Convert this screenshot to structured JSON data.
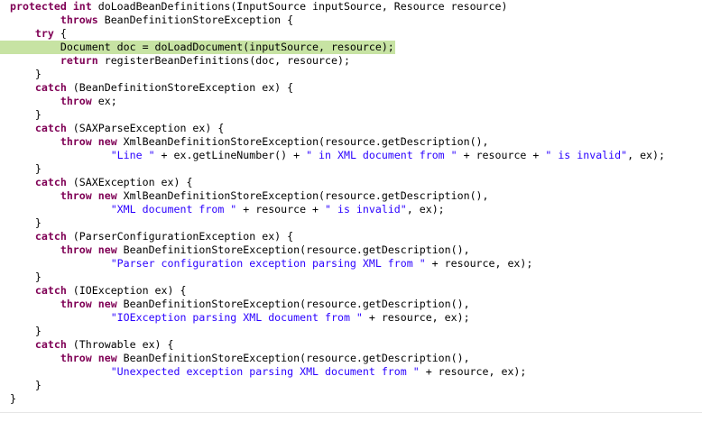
{
  "colors": {
    "keyword": "#7f0055",
    "string": "#2a00ff",
    "text": "#000000",
    "current_line": "#c7e3a3"
  },
  "lines": [
    [
      [
        "k",
        "protected"
      ],
      [
        "t",
        " "
      ],
      [
        "k",
        "int"
      ],
      [
        "t",
        " doLoadBeanDefinitions(InputSource inputSource, Resource resource)"
      ]
    ],
    [
      [
        "t",
        "        "
      ],
      [
        "k",
        "throws"
      ],
      [
        "t",
        " BeanDefinitionStoreException {"
      ]
    ],
    [
      [
        "t",
        "    "
      ],
      [
        "k",
        "try"
      ],
      [
        "t",
        " {"
      ]
    ],
    [
      [
        "t",
        "        Document doc = doLoadDocument(inputSource, resource);"
      ]
    ],
    [
      [
        "t",
        "        "
      ],
      [
        "k",
        "return"
      ],
      [
        "t",
        " registerBeanDefinitions(doc, resource);"
      ]
    ],
    [
      [
        "t",
        "    }"
      ]
    ],
    [
      [
        "t",
        "    "
      ],
      [
        "k",
        "catch"
      ],
      [
        "t",
        " (BeanDefinitionStoreException ex) {"
      ]
    ],
    [
      [
        "t",
        "        "
      ],
      [
        "k",
        "throw"
      ],
      [
        "t",
        " ex;"
      ]
    ],
    [
      [
        "t",
        "    }"
      ]
    ],
    [
      [
        "t",
        "    "
      ],
      [
        "k",
        "catch"
      ],
      [
        "t",
        " (SAXParseException ex) {"
      ]
    ],
    [
      [
        "t",
        "        "
      ],
      [
        "k",
        "throw"
      ],
      [
        "t",
        " "
      ],
      [
        "k",
        "new"
      ],
      [
        "t",
        " XmlBeanDefinitionStoreException(resource.getDescription(),"
      ]
    ],
    [
      [
        "t",
        "                "
      ],
      [
        "s",
        "\"Line \""
      ],
      [
        "t",
        " + ex.getLineNumber() + "
      ],
      [
        "s",
        "\" in XML document from \""
      ],
      [
        "t",
        " + resource + "
      ],
      [
        "s",
        "\" is invalid\""
      ],
      [
        "t",
        ", ex);"
      ]
    ],
    [
      [
        "t",
        "    }"
      ]
    ],
    [
      [
        "t",
        "    "
      ],
      [
        "k",
        "catch"
      ],
      [
        "t",
        " (SAXException ex) {"
      ]
    ],
    [
      [
        "t",
        "        "
      ],
      [
        "k",
        "throw"
      ],
      [
        "t",
        " "
      ],
      [
        "k",
        "new"
      ],
      [
        "t",
        " XmlBeanDefinitionStoreException(resource.getDescription(),"
      ]
    ],
    [
      [
        "t",
        "                "
      ],
      [
        "s",
        "\"XML document from \""
      ],
      [
        "t",
        " + resource + "
      ],
      [
        "s",
        "\" is invalid\""
      ],
      [
        "t",
        ", ex);"
      ]
    ],
    [
      [
        "t",
        "    }"
      ]
    ],
    [
      [
        "t",
        "    "
      ],
      [
        "k",
        "catch"
      ],
      [
        "t",
        " (ParserConfigurationException ex) {"
      ]
    ],
    [
      [
        "t",
        "        "
      ],
      [
        "k",
        "throw"
      ],
      [
        "t",
        " "
      ],
      [
        "k",
        "new"
      ],
      [
        "t",
        " BeanDefinitionStoreException(resource.getDescription(),"
      ]
    ],
    [
      [
        "t",
        "                "
      ],
      [
        "s",
        "\"Parser configuration exception parsing XML from \""
      ],
      [
        "t",
        " + resource, ex);"
      ]
    ],
    [
      [
        "t",
        "    }"
      ]
    ],
    [
      [
        "t",
        "    "
      ],
      [
        "k",
        "catch"
      ],
      [
        "t",
        " (IOException ex) {"
      ]
    ],
    [
      [
        "t",
        "        "
      ],
      [
        "k",
        "throw"
      ],
      [
        "t",
        " "
      ],
      [
        "k",
        "new"
      ],
      [
        "t",
        " BeanDefinitionStoreException(resource.getDescription(),"
      ]
    ],
    [
      [
        "t",
        "                "
      ],
      [
        "s",
        "\"IOException parsing XML document from \""
      ],
      [
        "t",
        " + resource, ex);"
      ]
    ],
    [
      [
        "t",
        "    }"
      ]
    ],
    [
      [
        "t",
        "    "
      ],
      [
        "k",
        "catch"
      ],
      [
        "t",
        " (Throwable ex) {"
      ]
    ],
    [
      [
        "t",
        "        "
      ],
      [
        "k",
        "throw"
      ],
      [
        "t",
        " "
      ],
      [
        "k",
        "new"
      ],
      [
        "t",
        " BeanDefinitionStoreException(resource.getDescription(),"
      ]
    ],
    [
      [
        "t",
        "                "
      ],
      [
        "s",
        "\"Unexpected exception parsing XML document from \""
      ],
      [
        "t",
        " + resource, ex);"
      ]
    ],
    [
      [
        "t",
        "    }"
      ]
    ],
    [
      [
        "t",
        "}"
      ]
    ]
  ],
  "current_line_index": 3
}
